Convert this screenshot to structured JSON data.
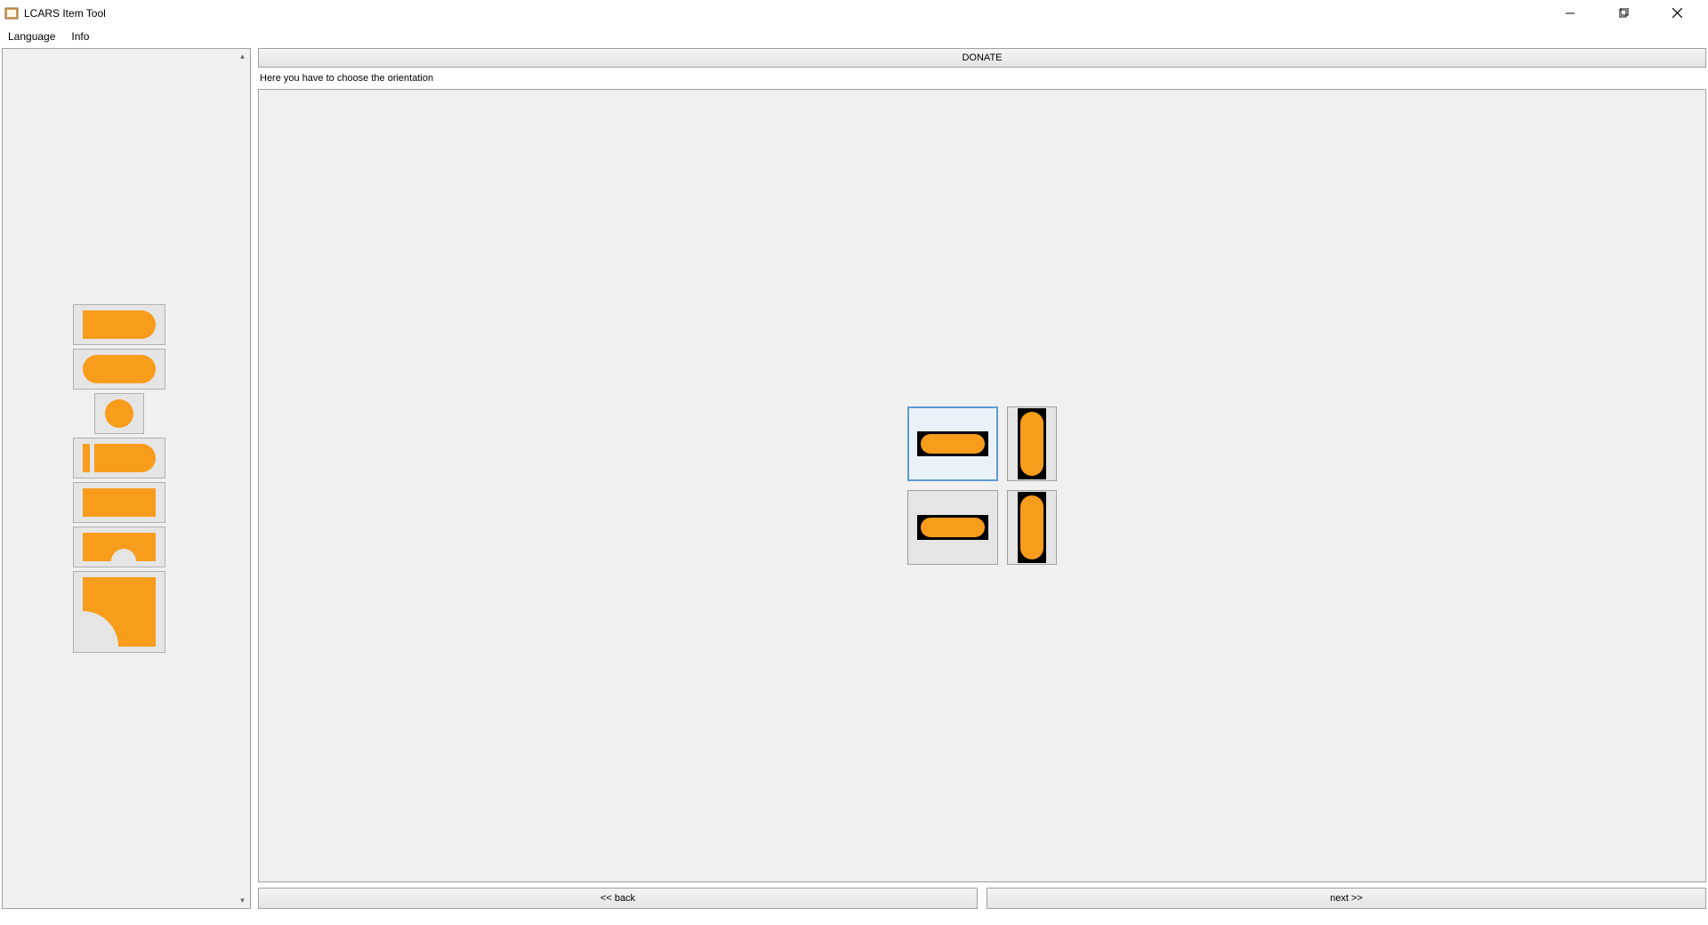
{
  "window": {
    "title": "LCARS Item Tool"
  },
  "menu": {
    "language": "Language",
    "info": "Info"
  },
  "main": {
    "donate_label": "DONATE",
    "instruction": "Here you have to choose the orientation",
    "back_label": "<< back",
    "next_label": "next >>"
  },
  "colors": {
    "shape_fill": "#f89c1c",
    "shape_dark": "#000000"
  }
}
